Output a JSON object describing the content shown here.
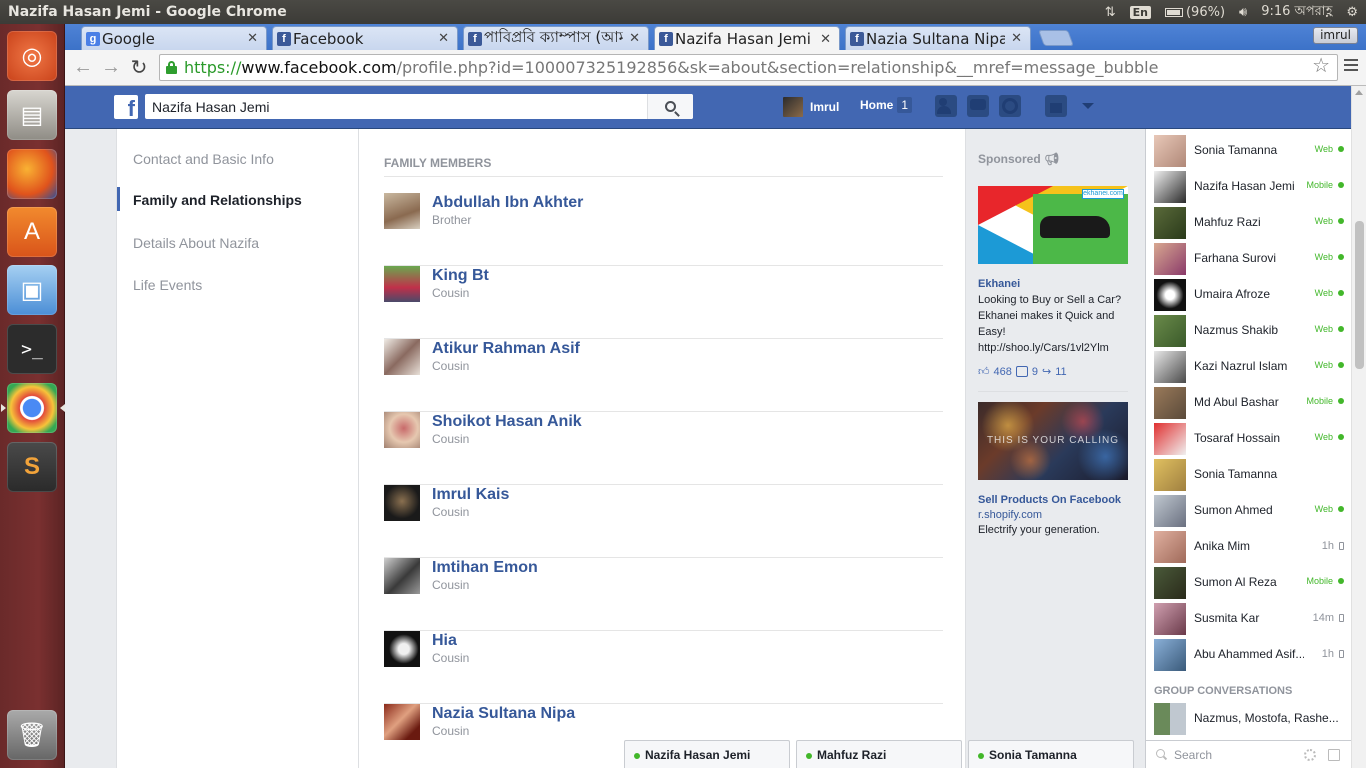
{
  "window": {
    "title": "Nazifa Hasan Jemi - Google Chrome",
    "keyboard": "En",
    "battery": "(96%)",
    "time": "9:16 অপরাহ্ণ"
  },
  "browser": {
    "tabs": [
      {
        "label": "Google"
      },
      {
        "label": "Facebook"
      },
      {
        "label": "পাবিপ্রবি ক্যাম্পাস (আমাদে"
      },
      {
        "label": "Nazifa Hasan Jemi"
      },
      {
        "label": "Nazia Sultana Nipa"
      }
    ],
    "profile": "imrul",
    "url_scheme": "https://",
    "url_host": "www.facebook.com",
    "url_path": "/profile.php?id=100007325192856&sk=about&section=relationship&__mref=message_bubble"
  },
  "fb_header": {
    "search_value": "Nazifa Hasan Jemi",
    "user_name": "Imrul",
    "home_label": "Home",
    "home_count": "1"
  },
  "about_nav": {
    "items": [
      {
        "label": "Contact and Basic Info"
      },
      {
        "label": "Family and Relationships"
      },
      {
        "label": "Details About Nazifa"
      },
      {
        "label": "Life Events"
      }
    ]
  },
  "family": {
    "heading": "FAMILY MEMBERS",
    "members": [
      {
        "name": "Abdullah Ibn Akhter",
        "relation": "Brother"
      },
      {
        "name": "King Bt",
        "relation": "Cousin"
      },
      {
        "name": "Atikur Rahman Asif",
        "relation": "Cousin"
      },
      {
        "name": "Shoikot Hasan Anik",
        "relation": "Cousin"
      },
      {
        "name": "Imrul Kais",
        "relation": "Cousin"
      },
      {
        "name": "Imtihan Emon",
        "relation": "Cousin"
      },
      {
        "name": "Hia",
        "relation": "Cousin"
      },
      {
        "name": "Nazia Sultana Nipa",
        "relation": "Cousin"
      }
    ]
  },
  "ads": {
    "sponsored": "Sponsored",
    "ad1": {
      "brand_logo": "ekhanei.com",
      "title": "Ekhanei",
      "body": "Looking to Buy or Sell a Car? Ekhanei makes it Quick and Easy! http://shoo.ly/Cars/1vl2Ylm",
      "likes": "468",
      "comments": "9",
      "shares": "11"
    },
    "ad2": {
      "image_text": "THIS IS YOUR CALLING",
      "title": "Sell Products On Facebook",
      "domain": "r.shopify.com",
      "body": "Electrify your generation."
    }
  },
  "chat": {
    "friends": [
      {
        "name": "Sonia Tamanna",
        "status": "Web"
      },
      {
        "name": "Nazifa Hasan Jemi",
        "status": "Mobile"
      },
      {
        "name": "Mahfuz Razi",
        "status": "Web"
      },
      {
        "name": "Farhana Surovi",
        "status": "Web"
      },
      {
        "name": "Umaira Afroze",
        "status": "Web"
      },
      {
        "name": "Nazmus Shakib",
        "status": "Web"
      },
      {
        "name": "Kazi Nazrul Islam",
        "status": "Web"
      },
      {
        "name": "Md Abul Bashar",
        "status": "Mobile"
      },
      {
        "name": "Tosaraf Hossain",
        "status": "Web"
      },
      {
        "name": "Sonia Tamanna",
        "status": ""
      },
      {
        "name": "Sumon Ahmed",
        "status": "Web"
      },
      {
        "name": "Anika Mim",
        "status": "1h"
      },
      {
        "name": "Sumon Al Reza",
        "status": "Mobile"
      },
      {
        "name": "Susmita Kar",
        "status": "14m"
      },
      {
        "name": "Abu Ahammed Asif...",
        "status": "1h"
      }
    ],
    "group_heading": "GROUP CONVERSATIONS",
    "group_name": "Nazmus, Mostofa, Rashe...",
    "search_placeholder": "Search"
  },
  "chat_tabs": [
    {
      "name": "Nazifa Hasan Jemi"
    },
    {
      "name": "Mahfuz Razi"
    },
    {
      "name": "Sonia Tamanna"
    }
  ],
  "colors": {
    "fb_blue": "#4267b2",
    "link": "#365899",
    "online_green": "#42b72a"
  }
}
